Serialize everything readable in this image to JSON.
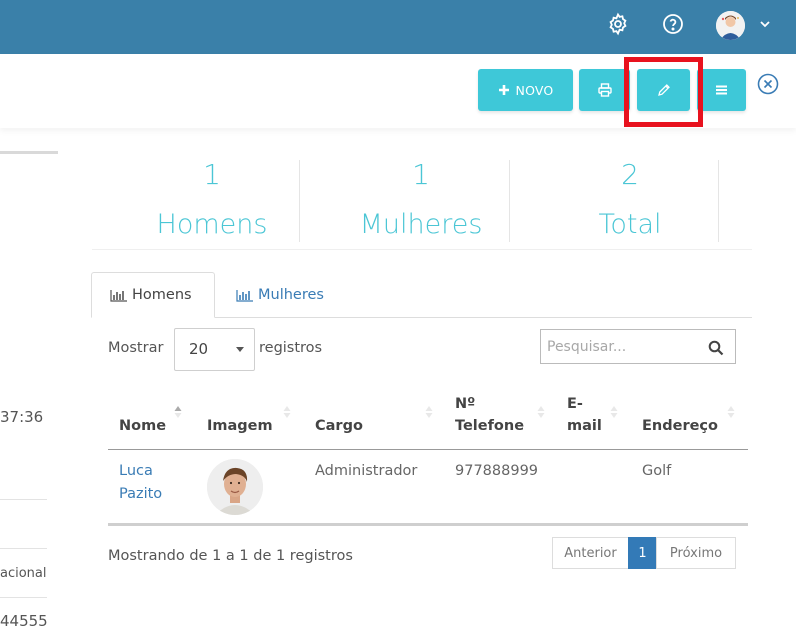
{
  "toolbar": {
    "novo_label": "NOVO"
  },
  "left_panel": {
    "time_fragment": "37:36",
    "nationality_fragment": "acional",
    "phone_fragment": "44555"
  },
  "stats": [
    {
      "value": "1",
      "label": "Homens"
    },
    {
      "value": "1",
      "label": "Mulheres"
    },
    {
      "value": "2",
      "label": "Total"
    }
  ],
  "tabs": [
    {
      "label": "Homens",
      "active": true
    },
    {
      "label": "Mulheres",
      "active": false
    }
  ],
  "table_controls": {
    "show_label": "Mostrar",
    "page_size": "20",
    "records_label": "registros",
    "search_placeholder": "Pesquisar..."
  },
  "table": {
    "columns": [
      {
        "line1": "",
        "line2": "Nome"
      },
      {
        "line1": "",
        "line2": "Imagem"
      },
      {
        "line1": "",
        "line2": "Cargo"
      },
      {
        "line1": "Nº",
        "line2": "Telefone"
      },
      {
        "line1": "E-",
        "line2": "mail"
      },
      {
        "line1": "",
        "line2": "Endereço"
      }
    ],
    "rows": [
      {
        "nome_line1": "Luca",
        "nome_line2": "Pazito",
        "image": "profile-photo",
        "cargo": "Administrador",
        "telefone": "977888999",
        "email": "",
        "endereco": "Golf"
      }
    ]
  },
  "footer": {
    "info": "Mostrando de 1 a 1 de 1 registros",
    "prev_label": "Anterior",
    "current_page": "1",
    "next_label": "Próximo"
  },
  "icons": {
    "settings": "gear-icon",
    "help": "help-circle-icon",
    "user": "user-avatar",
    "dropdown": "chevron-down-icon",
    "novo": "plus-icon",
    "print": "printer-icon",
    "edit": "pencil-icon",
    "menu": "hamburger-icon",
    "close": "close-circle-icon",
    "tabs": "bar-chart-icon",
    "search": "search-icon",
    "sort": "sort-arrows-icon"
  },
  "colors": {
    "topbar": "#3a80a9",
    "button": "#3ec8d8",
    "stat_text": "#4bc6d5",
    "link": "#3a7cb5",
    "highlight": "#e8121e",
    "pagination_active": "#337ab7"
  }
}
